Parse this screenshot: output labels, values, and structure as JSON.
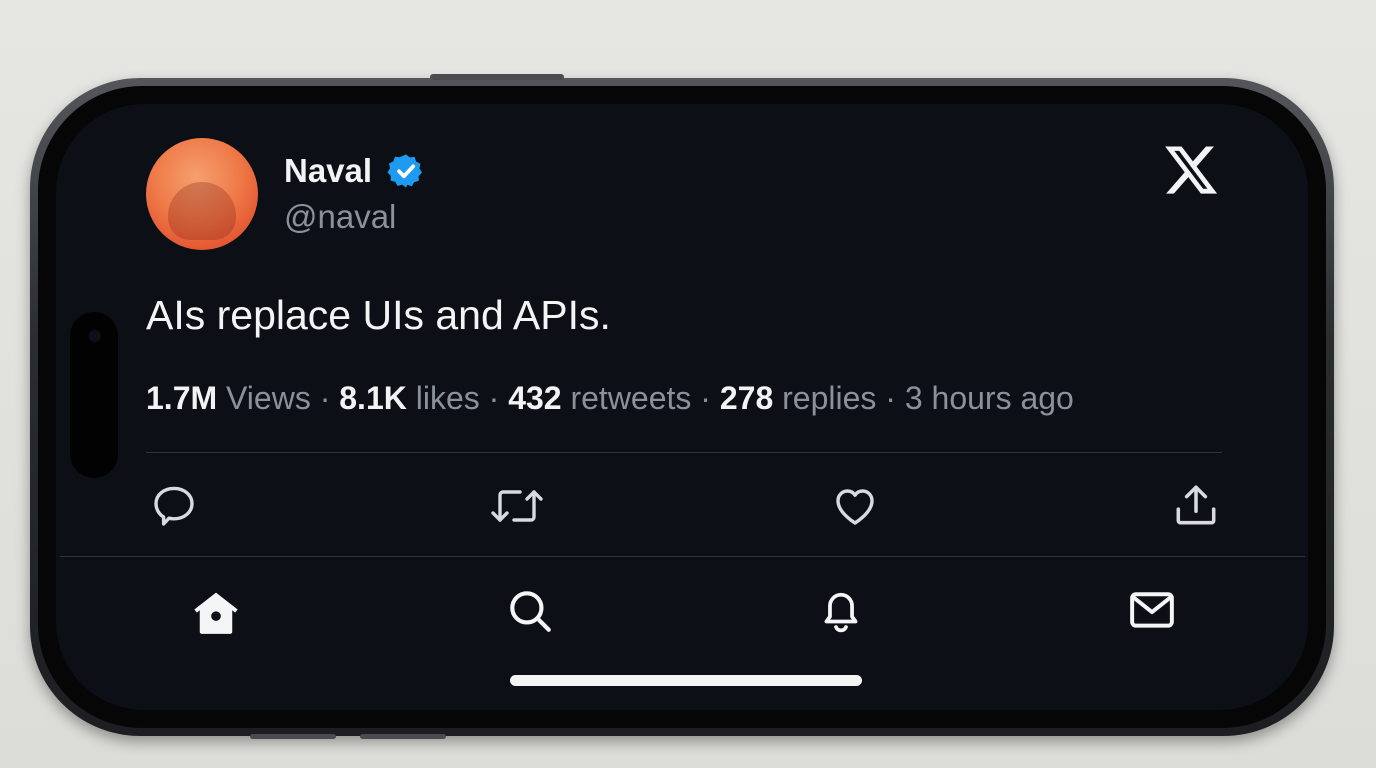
{
  "tweet": {
    "author_name": "Naval",
    "handle": "@naval",
    "verified": true,
    "text": "AIs replace UIs and APIs.",
    "stats": {
      "views_value": "1.7M",
      "views_label": "Views",
      "likes_value": "8.1K",
      "likes_label": "likes",
      "retweets_value": "432",
      "retweets_label": "retweets",
      "replies_value": "278",
      "replies_label": "replies",
      "time": "3 hours ago",
      "separator": "·"
    },
    "actions": [
      "reply-icon",
      "retweet-icon",
      "like-icon",
      "share-icon"
    ]
  },
  "app": {
    "logo": "x-logo",
    "nav": [
      "home-icon",
      "search-icon",
      "notifications-icon",
      "messages-icon"
    ]
  },
  "colors": {
    "screen_background": "#0c0f15",
    "primary_text": "#f2f3f5",
    "secondary_text": "#8b9199",
    "verified_blue": "#1d9bf0",
    "avatar_orange": "#ef7a48"
  }
}
